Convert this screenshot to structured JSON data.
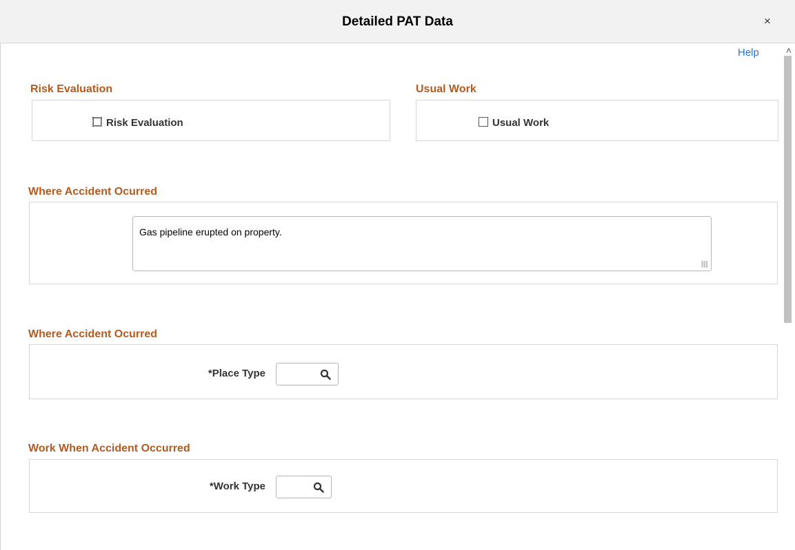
{
  "modal": {
    "title": "Detailed PAT Data",
    "close_symbol": "×"
  },
  "help": {
    "label": "Help"
  },
  "risk_evaluation": {
    "section_title": "Risk Evaluation",
    "checkbox_label": "Risk Evaluation",
    "checked": false
  },
  "usual_work": {
    "section_title": "Usual Work",
    "checkbox_label": "Usual Work",
    "checked": false
  },
  "where_accident_text": {
    "section_title": "Where Accident Ocurred",
    "value": "Gas pipeline erupted on property."
  },
  "where_accident_place": {
    "section_title": "Where Accident Ocurred",
    "label": "*Place Type",
    "value": ""
  },
  "work_when_accident": {
    "section_title": "Work When Accident Occurred",
    "label": "*Work Type",
    "value": ""
  },
  "colors": {
    "section_title": "#b35a1f",
    "link": "#2a70c9",
    "header_bg": "#f2f2f2"
  },
  "icons": {
    "lookup": "search-icon",
    "close": "close-icon",
    "scroll_up": "chevron-up-icon"
  }
}
